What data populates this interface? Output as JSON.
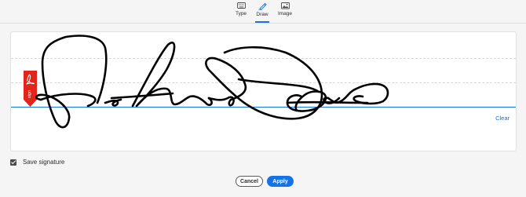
{
  "tabs": [
    {
      "label": "Type",
      "icon": "keyboard-icon",
      "active": false
    },
    {
      "label": "Draw",
      "icon": "pen-draw-icon",
      "active": true
    },
    {
      "label": "Image",
      "icon": "image-icon",
      "active": false
    }
  ],
  "pad": {
    "clear_label": "Clear",
    "sign_flag_text": "sign"
  },
  "options": {
    "save_signature_label": "Save signature",
    "save_signature_checked": true
  },
  "buttons": {
    "cancel_label": "Cancel",
    "apply_label": "Apply"
  },
  "colors": {
    "accent": "#1473e6",
    "flag_red": "#e1251b",
    "ink": "#000000"
  }
}
